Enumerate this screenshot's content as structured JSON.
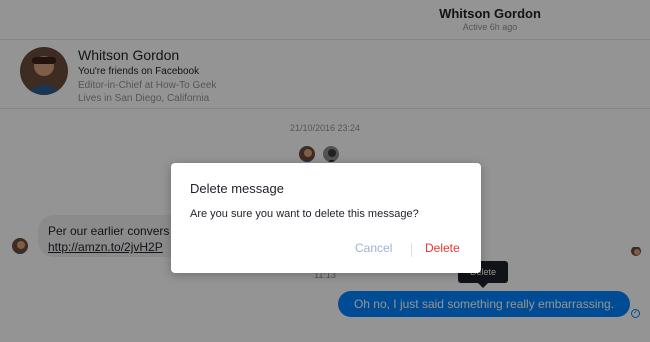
{
  "header": {
    "name": "Whitson Gordon",
    "status": "Active 6h ago"
  },
  "profile": {
    "name": "Whitson Gordon",
    "friends": "You're friends on Facebook",
    "job": "Editor-in-Chief at How-To Geek",
    "location": "Lives in San Diego, California"
  },
  "conversation": {
    "timestamp1": "21/10/2016 23:24",
    "incoming_line1": "Per our earlier convers",
    "incoming_link": "http://amzn.to/2jvH2P",
    "timestamp2": "11:13",
    "tooltip": "Delete",
    "outgoing": "Oh no, I just said something really embarrassing."
  },
  "dialog": {
    "title": "Delete message",
    "body": "Are you sure you want to delete this message?",
    "cancel_label": "Cancel",
    "delete_label": "Delete"
  },
  "icons": {
    "seen": "check-circle-icon"
  },
  "colors": {
    "accent": "#0084ff",
    "danger": "#e53935",
    "overlay": "rgba(0,0,0,0.42)"
  }
}
